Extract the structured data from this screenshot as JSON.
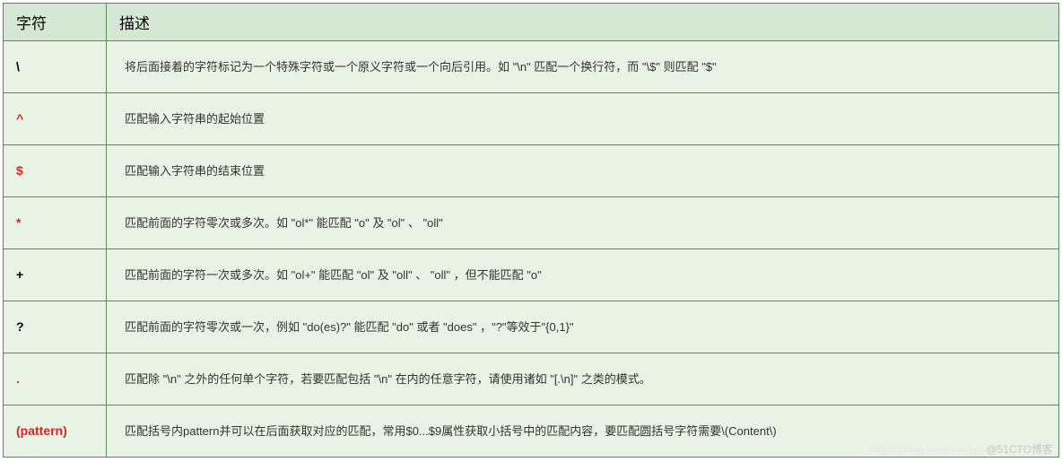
{
  "header": {
    "col1": "字符",
    "col2": "描述"
  },
  "rows": [
    {
      "char": "\\",
      "charColor": "black",
      "desc": "将后面接着的字符标记为一个特殊字符或一个原义字符或一个向后引用。如 \"\\n\" 匹配一个换行符，而 \"\\$\" 则匹配 \"$\""
    },
    {
      "char": "^",
      "charColor": "red",
      "desc": "匹配输入字符串的起始位置"
    },
    {
      "char": "$",
      "charColor": "red",
      "desc": "匹配输入字符串的结束位置"
    },
    {
      "char": "*",
      "charColor": "red",
      "desc": "匹配前面的字符零次或多次。如 \"ol*\" 能匹配 \"o\" 及 \"ol\" 、 \"oll\""
    },
    {
      "char": "+",
      "charColor": "black",
      "desc": "匹配前面的字符一次或多次。如 \"ol+\" 能匹配 \"ol\" 及 \"oll\" 、 \"oll\" ，但不能匹配 \"o\""
    },
    {
      "char": "?",
      "charColor": "black",
      "desc": "匹配前面的字符零次或一次，例如 \"do(es)?\" 能匹配 \"do\" 或者 \"does\" ，\"?\"等效于\"{0,1}\""
    },
    {
      "char": ".",
      "charColor": "red",
      "desc": "匹配除 \"\\n\" 之外的任何单个字符，若要匹配包括 \"\\n\" 在内的任意字符，请使用诸如 \"[.\\n]\" 之类的模式。"
    },
    {
      "char": "(pattern)",
      "charColor": "red",
      "desc": "匹配括号内pattern并可以在后面获取对应的匹配，常用$0...$9属性获取小括号中的匹配内容，要匹配圆括号字符需要\\(Content\\)"
    }
  ],
  "watermark": {
    "faint": "https://blog.csdn.net/qq",
    "main": "@51CTO博客"
  }
}
